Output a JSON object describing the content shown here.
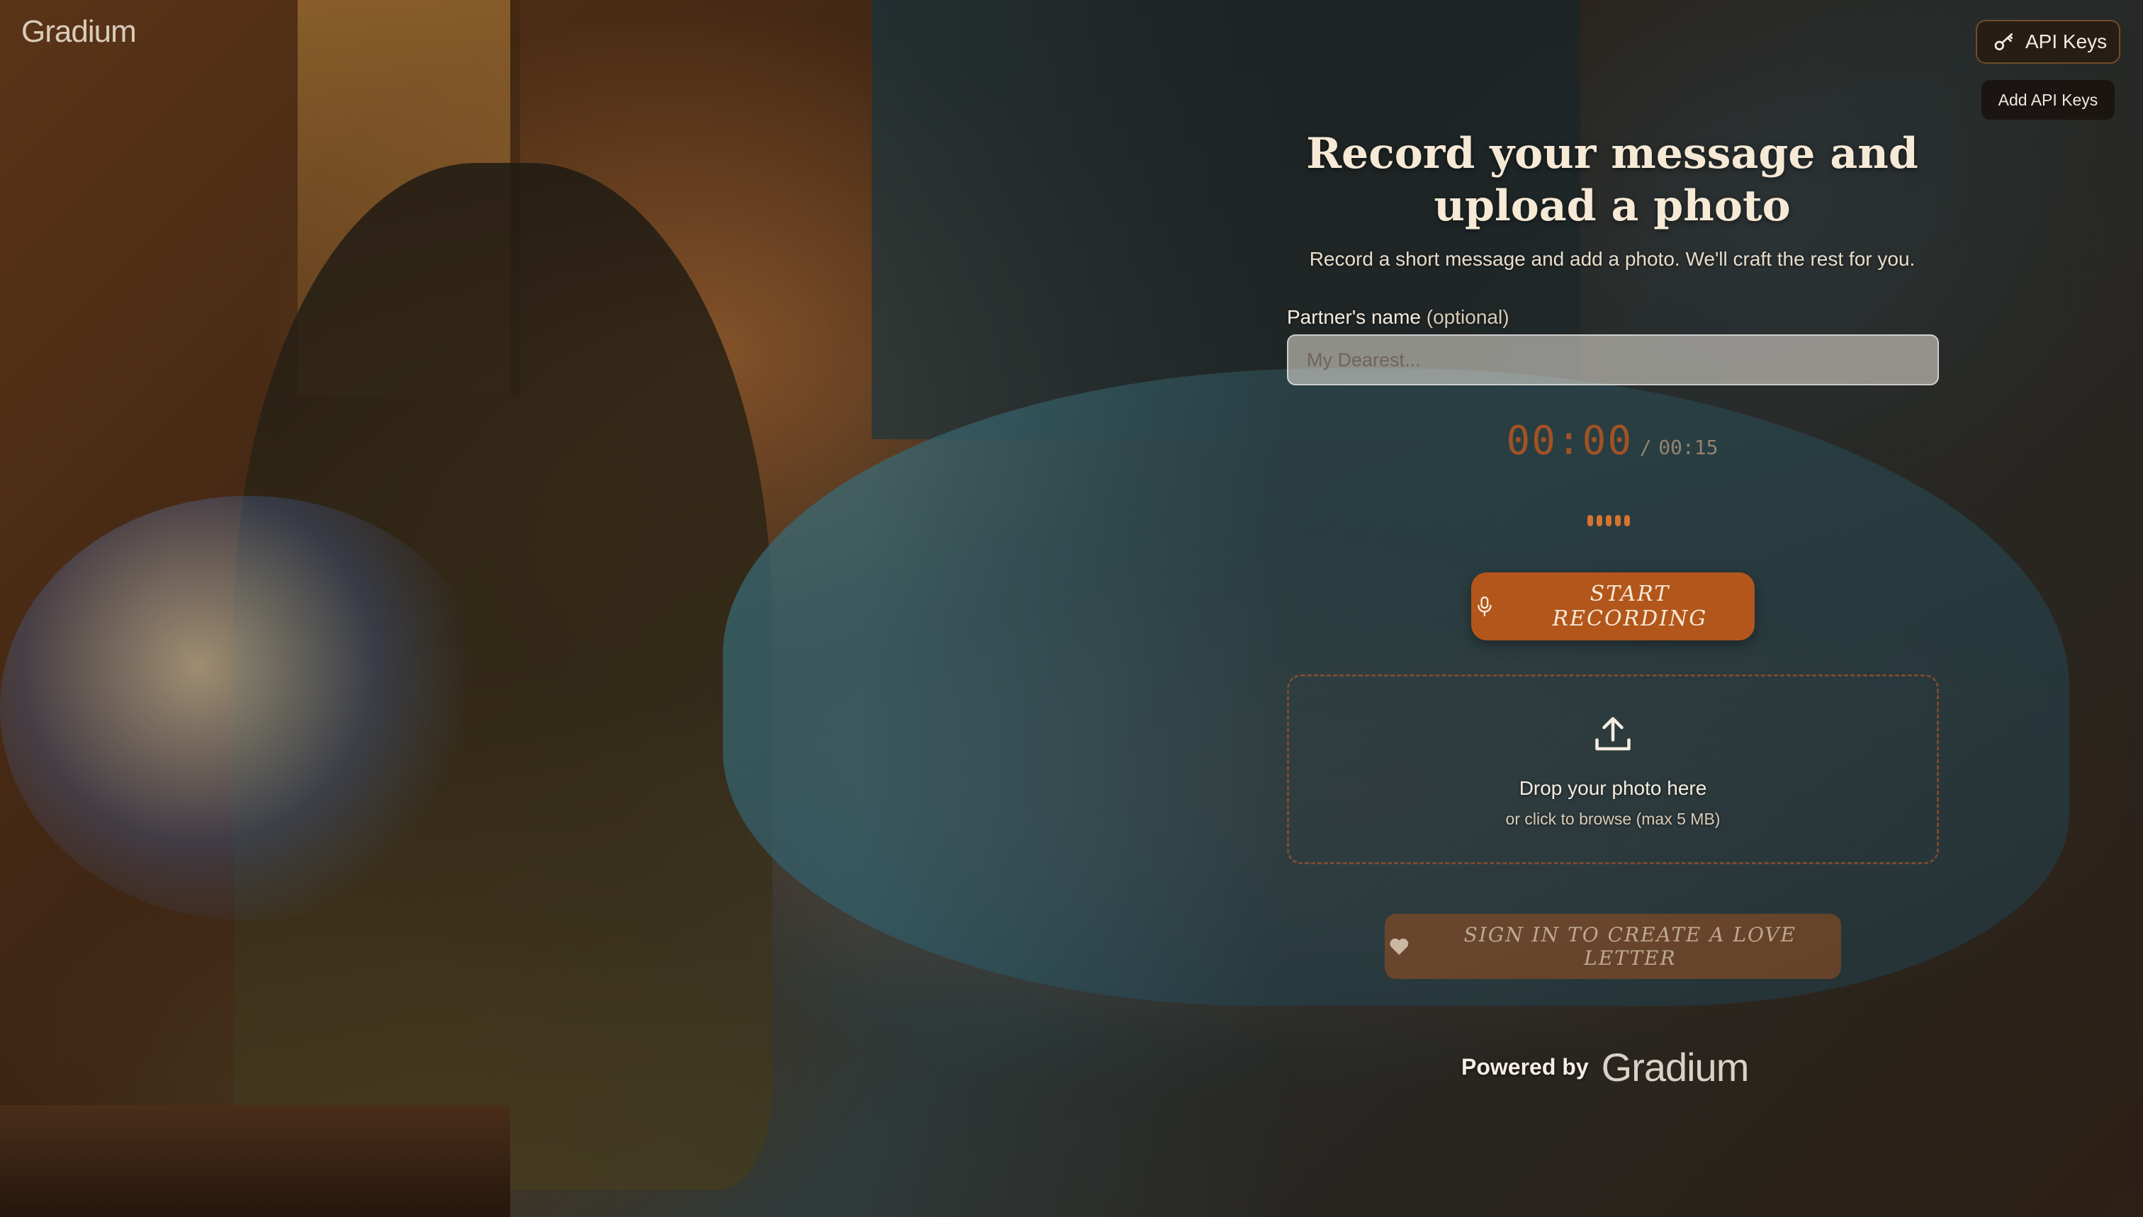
{
  "brand": {
    "logo_text": "Gradium"
  },
  "header": {
    "api_keys_label": "API Keys",
    "api_keys_tooltip": "Add API Keys"
  },
  "main": {
    "title": "Record your message and upload a photo",
    "subtitle": "Record a short message and add a photo. We'll craft the rest for you.",
    "partner_label": "Partner's name",
    "partner_optional": "(optional)",
    "partner_placeholder": "My Dearest...",
    "timer_current": "00:00",
    "timer_separator": "/",
    "timer_max": "00:15",
    "record_label": "START RECORDING",
    "drop_title": "Drop your photo here",
    "drop_hint": "or click to browse (max 5 MB)",
    "sign_in_label": "SIGN IN TO CREATE A LOVE LETTER"
  },
  "footer": {
    "powered_by": "Powered by",
    "powered_logo": "Gradium"
  },
  "colors": {
    "accent": "#b3561b",
    "timer": "#b8561f",
    "title": "#f6e9d6"
  },
  "icons": {
    "api": "key-icon",
    "record": "microphone-icon",
    "upload": "upload-icon",
    "sign_in": "heart-icon"
  }
}
